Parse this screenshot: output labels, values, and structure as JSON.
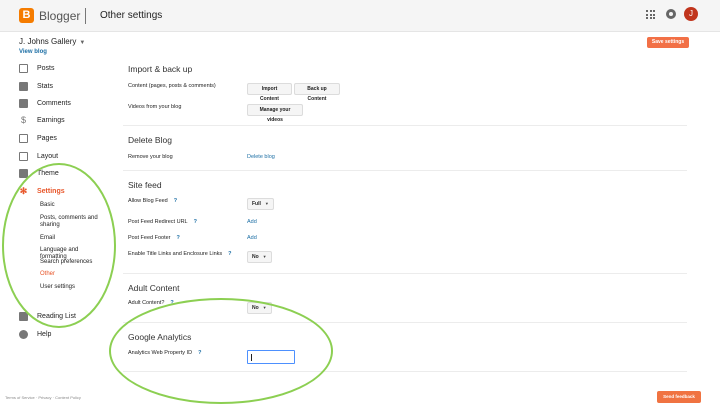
{
  "topbar": {
    "logo_letter": "B",
    "brand": "Blogger",
    "page_heading": "Other settings",
    "avatar_letter": "J",
    "icons": [
      "apps-grid-icon",
      "notifications-icon"
    ]
  },
  "sidebar": {
    "blog_name": "J. Johns Gallery",
    "view_blog": "View blog",
    "items": [
      {
        "label": "Posts",
        "icon": "posts-icon"
      },
      {
        "label": "Stats",
        "icon": "stats-icon"
      },
      {
        "label": "Comments",
        "icon": "comments-icon"
      },
      {
        "label": "Earnings",
        "icon": "dollar-icon"
      },
      {
        "label": "Pages",
        "icon": "pages-icon"
      },
      {
        "label": "Layout",
        "icon": "layout-icon"
      },
      {
        "label": "Theme",
        "icon": "theme-icon"
      },
      {
        "label": "Settings",
        "icon": "gear-icon"
      }
    ],
    "settings_sub": [
      "Basic",
      "Posts, comments and sharing",
      "Email",
      "Language and formatting",
      "Search preferences",
      "Other",
      "User settings"
    ],
    "active_sub": "Other",
    "reading_list": "Reading List",
    "help": "Help"
  },
  "actions": {
    "save": "Save settings",
    "send_feedback": "Send feedback"
  },
  "footer": {
    "terms": "Terms of Service",
    "privacy": "Privacy",
    "content_policy": "Content Policy",
    "separator": "·"
  },
  "import_backup": {
    "title": "Import & back up",
    "content_label": "Content (pages, posts & comments)",
    "import_btn": "Import Content",
    "backup_btn": "Back up Content",
    "videos_label": "Videos from your blog",
    "manage_videos_btn": "Manage your videos"
  },
  "delete_blog": {
    "title": "Delete Blog",
    "remove_label": "Remove your blog",
    "delete_link": "Delete blog"
  },
  "site_feed": {
    "title": "Site feed",
    "allow_label": "Allow Blog Feed",
    "allow_value": "Full",
    "redirect_label": "Post Feed Redirect URL",
    "redirect_link": "Add",
    "footer_label": "Post Feed Footer",
    "footer_link": "Add",
    "enclosure_label": "Enable Title Links and Enclosure Links",
    "enclosure_value": "No",
    "help_mark": "?"
  },
  "adult_content": {
    "title": "Adult Content",
    "label": "Adult Content?",
    "value": "No"
  },
  "analytics": {
    "title": "Google Analytics",
    "label": "Analytics Web Property ID",
    "value": ""
  },
  "colors": {
    "accent": "#f27046",
    "active_nav": "#e8562a",
    "link": "#1d6fa5",
    "annotation": "#8ccf52"
  }
}
